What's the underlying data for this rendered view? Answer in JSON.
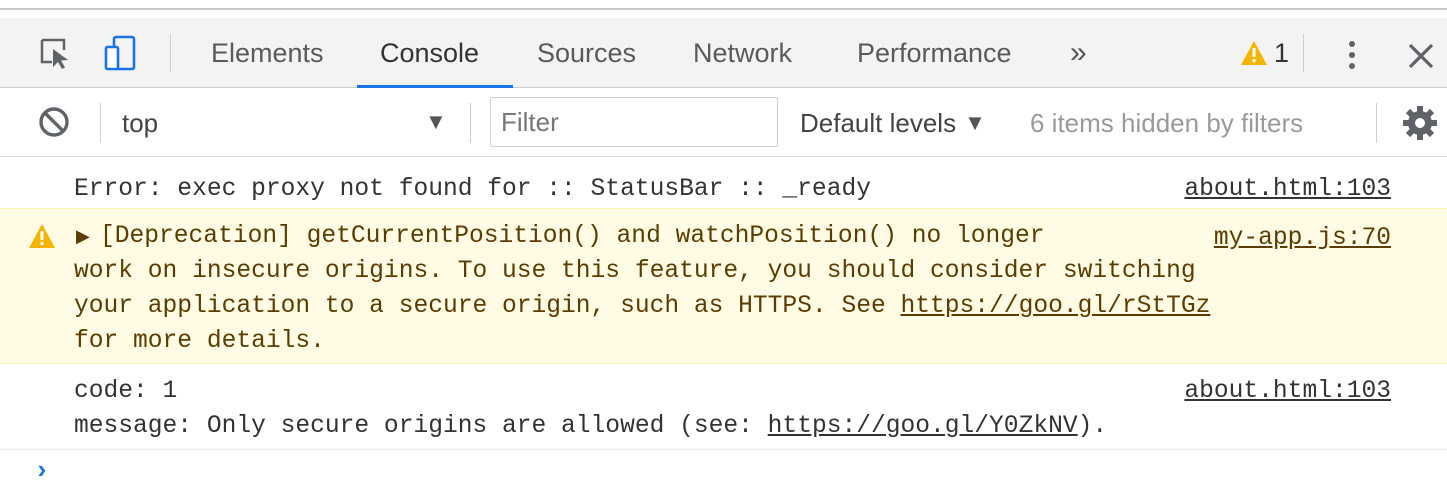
{
  "tabs": [
    {
      "label": "Elements"
    },
    {
      "label": "Console"
    },
    {
      "label": "Sources"
    },
    {
      "label": "Network"
    },
    {
      "label": "Performance"
    }
  ],
  "more_tabs": "»",
  "warning_count": "1",
  "icons": {
    "inspect": "inspect-element-icon",
    "device": "device-toolbar-icon",
    "more_tabs": "chevron-double-right-icon",
    "warning": "warning-triangle-icon",
    "menu": "kebab-menu-icon",
    "close": "close-icon",
    "clear": "clear-console-icon",
    "dropdown": "triangle-down-icon",
    "settings": "gear-icon",
    "expand": "triangle-right-icon",
    "prompt": "chevron-right-icon"
  },
  "toolbar": {
    "context": "top",
    "filter_placeholder": "Filter",
    "levels": "Default levels",
    "hidden_note": "6 items hidden by filters"
  },
  "messages": {
    "error": {
      "text": "Error: exec proxy not found for :: StatusBar :: _ready",
      "source": "about.html:103"
    },
    "warning": {
      "line1": "[Deprecation] getCurrentPosition() and watchPosition() no longer",
      "line2": "work on insecure origins. To use this feature, you should consider switching",
      "line3_prefix": "your application to a secure origin, such as HTTPS. See ",
      "line3_link": "https://goo.gl/rStTGz",
      "line4": "for more details.",
      "source": "my-app.js:70"
    },
    "log": {
      "line1": "code: 1",
      "line2_prefix": "message: Only secure origins are allowed (see: ",
      "line2_link": "https://goo.gl/Y0ZkNV",
      "line2_suffix": ").",
      "source": "about.html:103"
    }
  },
  "prompt": "›",
  "colors": {
    "accent": "#1a73e8",
    "warning_bg": "#fffbe5",
    "warning_icon": "#f4b400",
    "warning_text": "#5c3c00"
  }
}
